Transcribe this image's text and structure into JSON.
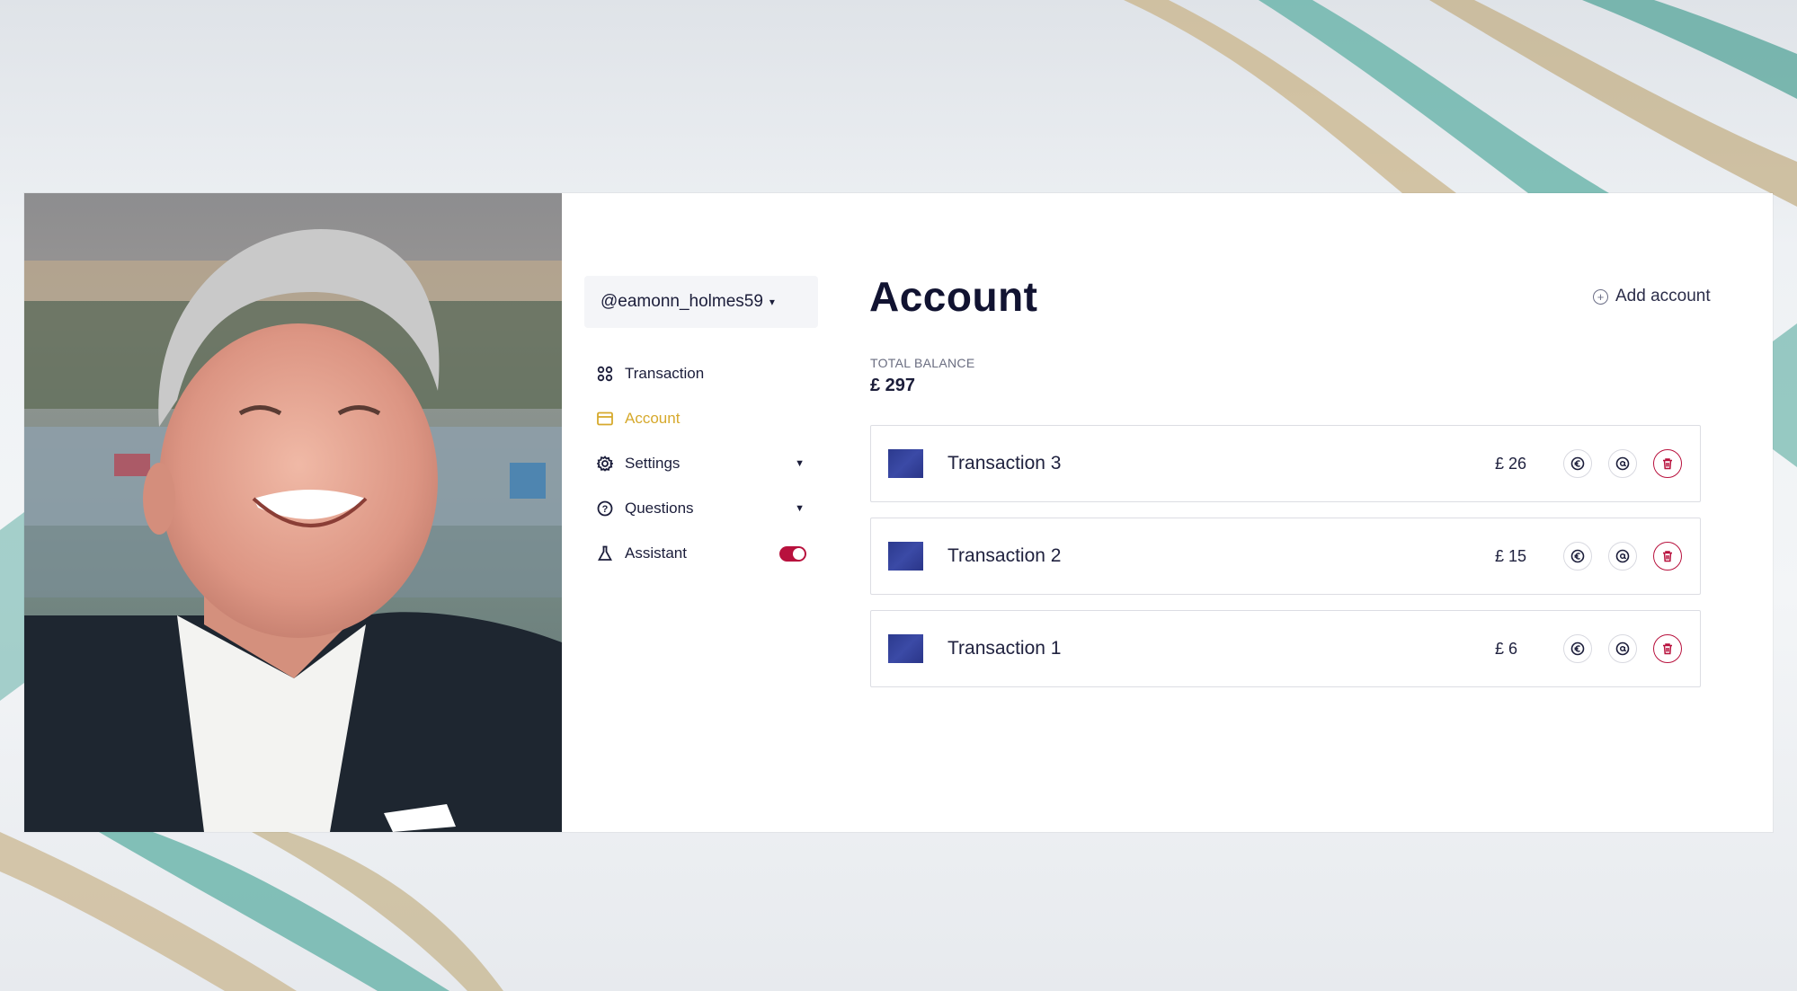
{
  "user": {
    "handle": "@eamonn_holmes59"
  },
  "nav": {
    "items": [
      {
        "label": "Transaction",
        "icon": "grid-icon"
      },
      {
        "label": "Account",
        "icon": "card-icon",
        "active": true
      },
      {
        "label": "Settings",
        "icon": "gear-icon",
        "expandable": true
      },
      {
        "label": "Questions",
        "icon": "question-icon",
        "expandable": true
      },
      {
        "label": "Assistant",
        "icon": "flask-icon",
        "toggle": true
      }
    ]
  },
  "page": {
    "title": "Account",
    "add_account_label": "Add account"
  },
  "balance": {
    "label": "TOTAL BALANCE",
    "value": "£ 297"
  },
  "transactions": [
    {
      "name": "Transaction 3",
      "amount": "£ 26"
    },
    {
      "name": "Transaction 2",
      "amount": "£ 15"
    },
    {
      "name": "Transaction 1",
      "amount": "£ 6"
    }
  ],
  "colors": {
    "accent": "#d6a92c",
    "danger": "#b8113d",
    "text": "#1b1d3a"
  }
}
